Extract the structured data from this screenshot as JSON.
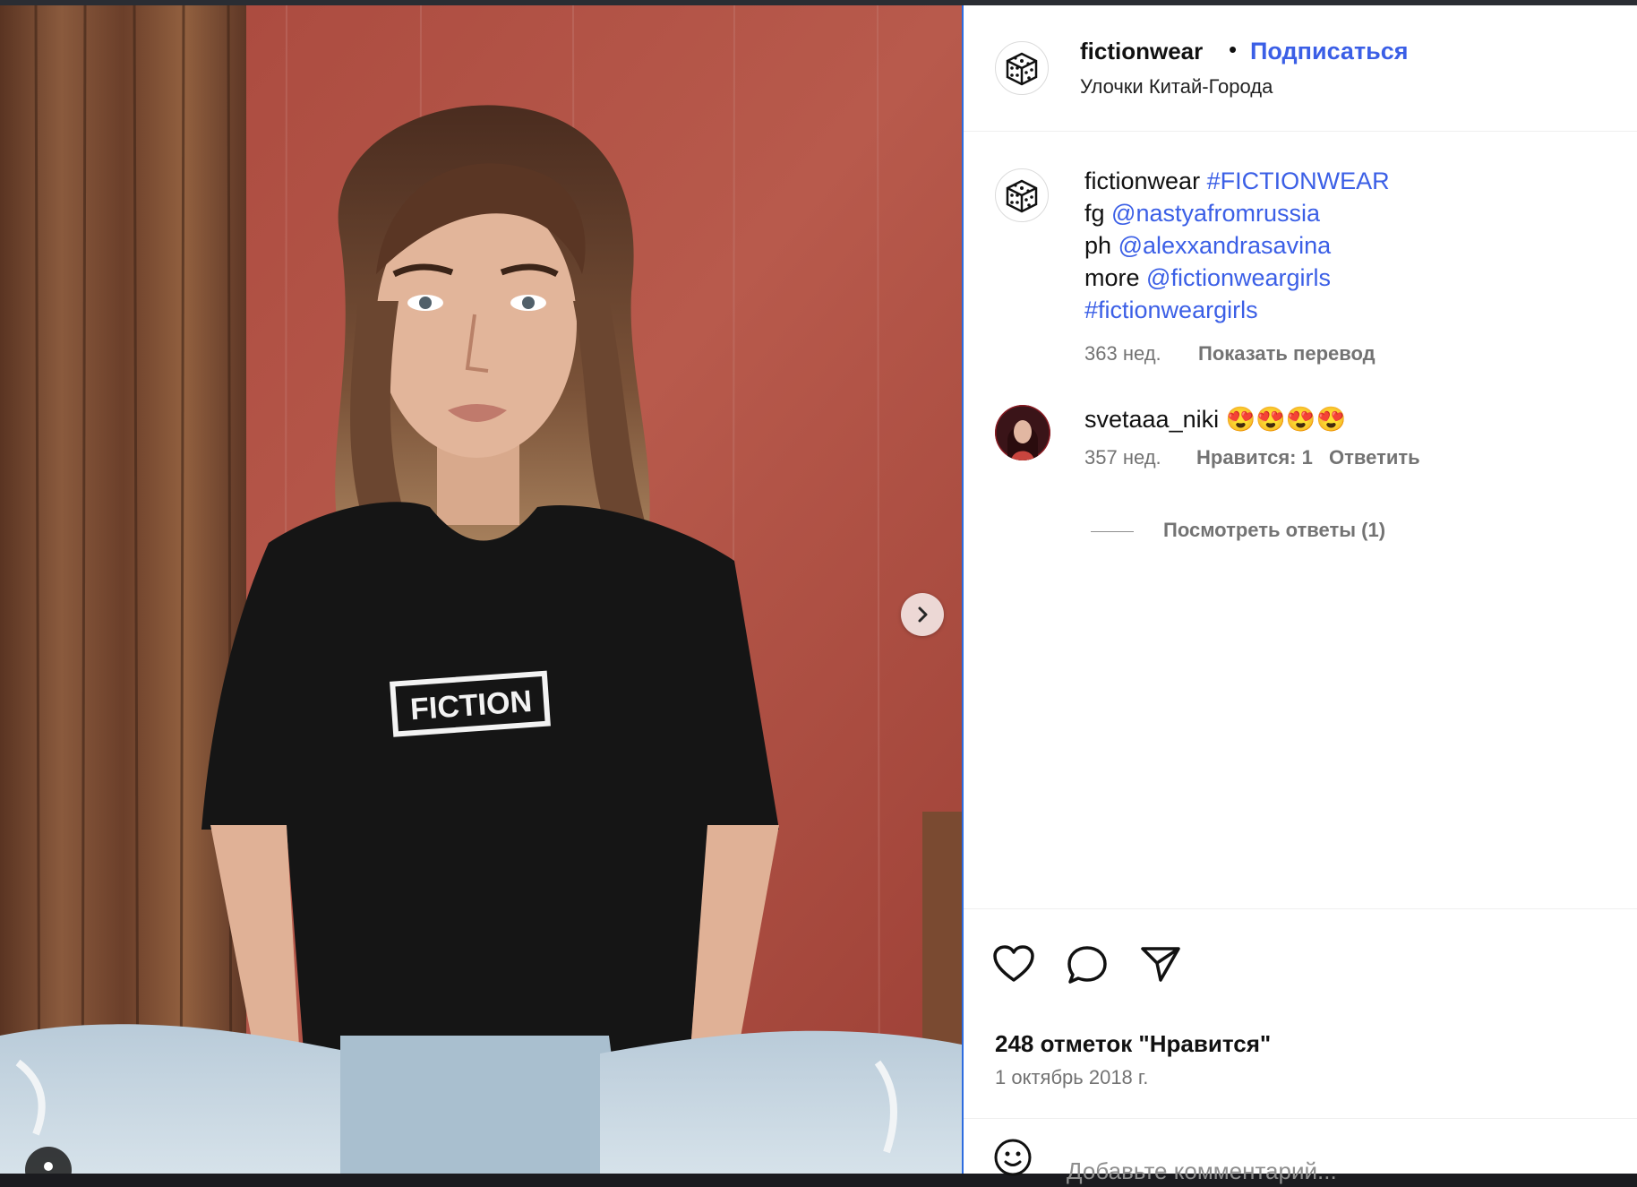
{
  "post": {
    "username": "fictionwear",
    "separator": "•",
    "follow_label": "Подписаться",
    "location": "Улочки Китай-Города",
    "shirt_logo_text": "FICTION"
  },
  "caption": {
    "username": "fictionwear",
    "hashtag_main": "#FICTIONWEAR",
    "line2_prefix": "fg",
    "line2_mention": "@nastyafromrussia",
    "line3_prefix": "ph",
    "line3_mention": "@alexxandrasavina",
    "line4_prefix": "more",
    "line4_mention": "@fictionweargirls",
    "line5_hashtag": "#fictionweargirls",
    "time": "363 нед.",
    "translate_label": "Показать перевод"
  },
  "comment": {
    "username": "svetaaa_niki",
    "text": "😍😍😍😍",
    "time": "357 нед.",
    "likes_label": "Нравится: 1",
    "reply_label": "Ответить",
    "view_replies_label": "Посмотреть ответы (1)"
  },
  "footer": {
    "likes_text": "248 отметок \"Нравится\"",
    "date_text": "1 октябрь 2018 г.",
    "comment_placeholder": "Добавьте комментарий..."
  },
  "icons": {
    "like": "heart-icon",
    "comment": "comment-icon",
    "share": "paper-plane-icon",
    "emoji": "smiley-icon",
    "next": "chevron-right-icon",
    "tag": "person-icon"
  },
  "colors": {
    "link": "#3b5fe6",
    "secondary_text": "#737373",
    "wall_red": "#b04a3e",
    "wood_brown": "#6b3f2a"
  }
}
